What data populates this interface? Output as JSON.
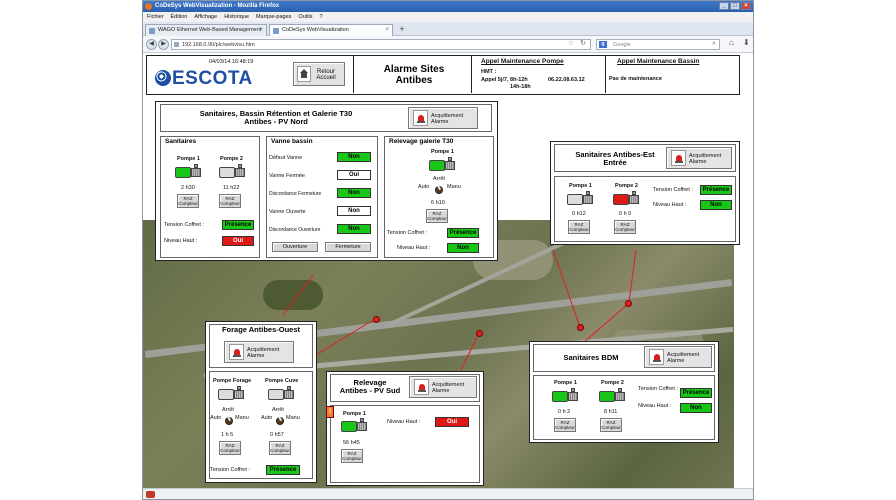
{
  "browser": {
    "window_title": "CoDeSys WebVisualization - Mozilla Firefox",
    "menu": [
      "Fichier",
      "Édition",
      "Affichage",
      "Historique",
      "Marque-pages",
      "Outils",
      "?"
    ],
    "tabs": [
      {
        "label": "WAGO Ethernet Web-Based Management"
      },
      {
        "label": "CoDeSys WebVisualization"
      }
    ],
    "url": "192.168.0.90/plc/webvisu.htm",
    "search_placeholder": "Google"
  },
  "header": {
    "datetime": "04/03/14 16:48:19",
    "logo": "ESCOTA",
    "retour_label": "Retour Accueil",
    "title_line1": "Alarme Sites",
    "title_line2": "Antibes",
    "maint_pompe": {
      "title": "Appel Maintenance Pompe",
      "hmt": "HMT :",
      "line1": "Appel 5j/7, 8h-12h",
      "phone": "06.22.08.63.12",
      "line2": "14h-18h"
    },
    "maint_bassin": {
      "title": "Appel Maintenance Bassin",
      "status": "Pas de maintenance"
    }
  },
  "ack_label": "Acquittement Alarme",
  "raz_label": "RAZ Compteur",
  "sanitaires_main": {
    "title_line1": "Sanitaires, Bassin Rétention et Galerie T30",
    "title_line2": "Antibes - PV Nord",
    "sanitaires": {
      "title": "Sanitaires",
      "pump1": {
        "label": "Pompe 1",
        "hours": "2 h30"
      },
      "pump2": {
        "label": "Pompe 2",
        "hours": "11 h22"
      },
      "tension_label": "Tension Coffret :",
      "tension_value": "Présence",
      "niveau_label": "Niveau Haut :",
      "niveau_value": "Oui"
    },
    "vanne": {
      "title": "Vanne bassin",
      "rows": [
        {
          "label": "Défaut Vanne",
          "value": "Non",
          "color": "green"
        },
        {
          "label": "Vanne Fermée",
          "value": "Oui",
          "color": "white"
        },
        {
          "label": "Discordance Fermeture",
          "value": "Non",
          "color": "green"
        },
        {
          "label": "Vanne Ouverte",
          "value": "Non",
          "color": "white"
        },
        {
          "label": "Discordance Ouverture",
          "value": "Non",
          "color": "green"
        }
      ],
      "open_label": "Ouverture",
      "close_label": "Fermeture"
    },
    "relevage": {
      "title": "Relevage galerie T30",
      "pump1": {
        "label": "Pompe 1",
        "hours": "6 h10"
      },
      "arret": "Arrêt",
      "auto": "Auto",
      "manu": "Manu",
      "tension_label": "Tension Coffret :",
      "tension_value": "Présence",
      "niveau_label": "Niveau Haut :",
      "niveau_value": "Non"
    }
  },
  "sanitaires_est": {
    "title_line1": "Sanitaires Antibes-Est",
    "title_line2": "Entrée",
    "pump1": {
      "label": "Pompe 1",
      "hours": "0 h12"
    },
    "pump2": {
      "label": "Pompe 2",
      "hours": "0 h 0"
    },
    "tension_label": "Tension Coffret :",
    "tension_value": "Présence",
    "niveau_label": "Niveau Haut :",
    "niveau_value": "Non"
  },
  "forage": {
    "title": "Forage Antibes-Ouest",
    "pump1": {
      "label": "Pompe Forage",
      "hours": "1 h 5"
    },
    "pump2": {
      "label": "Pompe Cuve",
      "hours": "0 h57"
    },
    "arret": "Arrêt",
    "auto": "Auto",
    "manu": "Manu",
    "tension_label": "Tension Coffret :",
    "tension_value": "Présence"
  },
  "relevage_sud": {
    "title_line1": "Relevage",
    "title_line2": "Antibes - PV Sud",
    "marker": "!",
    "pump1": {
      "label": "Pompe 1",
      "hours": "56 h45"
    },
    "niveau_label": "Niveau Haut :",
    "niveau_value": "Oui"
  },
  "sanitaires_bdm": {
    "title": "Sanitaires BDM",
    "pump1": {
      "label": "Pompe 1",
      "hours": "0 h 2"
    },
    "pump2": {
      "label": "Pompe 2",
      "hours": "8 h11"
    },
    "tension_label": "Tension Coffret :",
    "tension_value": "Présence",
    "niveau_label": "Niveau Haut :",
    "niveau_value": "Non"
  }
}
